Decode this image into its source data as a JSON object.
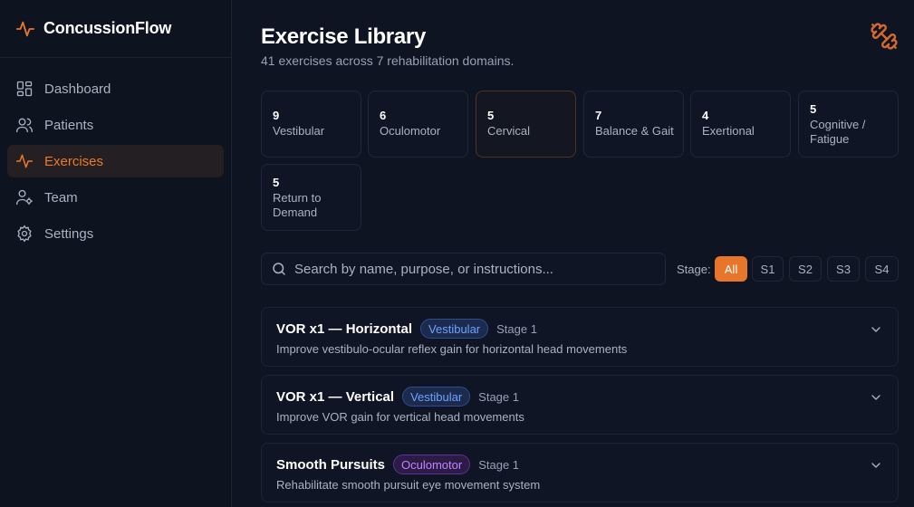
{
  "app": {
    "name": "ConcussionFlow",
    "accent": "#e8762a"
  },
  "sidebar": {
    "items": [
      {
        "label": "Dashboard",
        "icon": "dashboard-icon"
      },
      {
        "label": "Patients",
        "icon": "users-icon"
      },
      {
        "label": "Exercises",
        "icon": "activity-icon",
        "active": true
      },
      {
        "label": "Team",
        "icon": "user-gear-icon"
      },
      {
        "label": "Settings",
        "icon": "gear-icon"
      }
    ]
  },
  "header": {
    "title": "Exercise Library",
    "subtitle": "41 exercises across 7 rehabilitation domains.",
    "icon": "dumbbell-icon"
  },
  "domains": [
    {
      "count": "9",
      "label": "Vestibular"
    },
    {
      "count": "6",
      "label": "Oculomotor"
    },
    {
      "count": "5",
      "label": "Cervical",
      "selected": true
    },
    {
      "count": "7",
      "label": "Balance & Gait"
    },
    {
      "count": "4",
      "label": "Exertional"
    },
    {
      "count": "5",
      "label": "Cognitive / Fatigue"
    },
    {
      "count": "5",
      "label": "Return to Demand"
    }
  ],
  "search": {
    "placeholder": "Search by name, purpose, or instructions...",
    "value": ""
  },
  "stage_filter": {
    "label": "Stage:",
    "options": [
      "All",
      "S1",
      "S2",
      "S3",
      "S4"
    ],
    "selected": "All"
  },
  "exercises": [
    {
      "title": "VOR x1 — Horizontal",
      "domain": "Vestibular",
      "stage": "Stage 1",
      "description": "Improve vestibulo-ocular reflex gain for horizontal head movements"
    },
    {
      "title": "VOR x1 — Vertical",
      "domain": "Vestibular",
      "stage": "Stage 1",
      "description": "Improve VOR gain for vertical head movements"
    },
    {
      "title": "Smooth Pursuits",
      "domain": "Oculomotor",
      "stage": "Stage 1",
      "description": "Rehabilitate smooth pursuit eye movement system"
    }
  ]
}
